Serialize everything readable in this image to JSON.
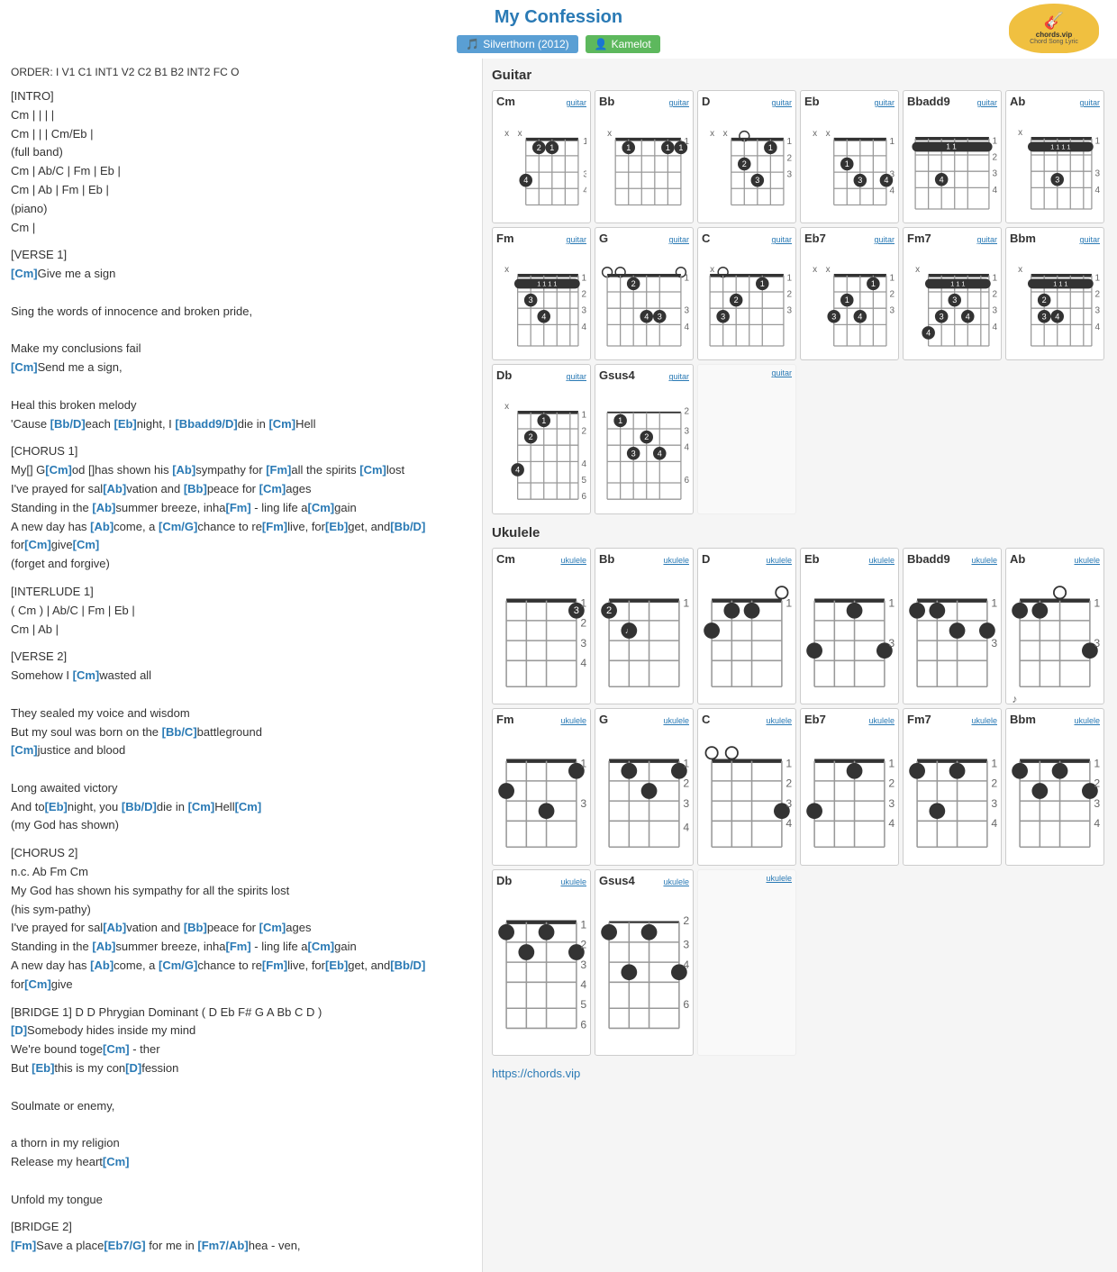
{
  "header": {
    "title": "My Confession",
    "badge_silverthorn": "Silverthorn (2012)",
    "badge_kamelot": "Kamelot",
    "logo_text": "chords.vip\nChord Song Lyric"
  },
  "order": "ORDER: I V1 C1 INT1 V2 C2 B1 B2 INT2 FC O",
  "sections": [
    {
      "label": "[INTRO]",
      "lines": [
        "Cm | | | |",
        "Cm | | | Cm/Eb |",
        "(full band)",
        "Cm | Ab/C | Fm | Eb |",
        "Cm | Ab | Fm | Eb |",
        "(piano)",
        "Cm |"
      ]
    },
    {
      "label": "[VERSE 1]",
      "lines": [
        "[Cm]Give me a sign",
        "",
        "Sing the words of innocence and broken pride,",
        "",
        "Make my conclusions fail",
        "[Cm]Send me a sign,",
        "",
        "Heal this broken melody",
        "'Cause [Bb/D]each [Eb]night, I [Bbadd9/D]die in [Cm]Hell"
      ]
    },
    {
      "label": "[CHORUS 1]",
      "lines": [
        "My[] G[Cm]od []has shown his [Ab]sympathy for [Fm]all the spirits [Cm]lost",
        "I've prayed for sal[Ab]vation and [Bb]peace for [Cm]ages",
        "Standing in the [Ab]summer breeze, inha[Fm] - ling life a[Cm]gain",
        "A new day has [Ab]come, a [Cm/G]chance to re[Fm]live, for[Eb]get, and[Bb/D]",
        "for[Cm]give[Cm]",
        "(forget and forgive)"
      ]
    },
    {
      "label": "[INTERLUDE 1]",
      "lines": [
        "( Cm ) | Ab/C | Fm | Eb |",
        "Cm | Ab |"
      ]
    },
    {
      "label": "[VERSE 2]",
      "lines": [
        "Somehow I [Cm]wasted all",
        "",
        "They sealed my voice and wisdom",
        "But my soul was born on the [Bb/C]battleground",
        "[Cm]justice and blood",
        "",
        "Long awaited victory",
        "And to[Eb]night, you [Bb/D]die in [Cm]Hell[Cm]",
        "(my God has shown)"
      ]
    },
    {
      "label": "[CHORUS 2]",
      "lines": [
        "n.c. Ab Fm Cm",
        "My God has shown his sympathy for all the spirits lost",
        "(his sym-pathy)",
        "I've prayed for sal[Ab]vation and [Bb]peace for [Cm]ages",
        "Standing in the [Ab]summer breeze, inha[Fm] - ling life a[Cm]gain",
        "A new day has [Ab]come, a [Cm/G]chance to re[Fm]live, for[Eb]get, and[Bb/D] for[Cm]give"
      ]
    },
    {
      "label": "[BRIDGE 1] D D Phrygian Dominant ( D Eb F# G A Bb C D )",
      "lines": [
        "[D]Somebody hides inside my mind",
        "We're bound toge[Cm] - ther",
        "But [Eb]this is my con[D]fession",
        "",
        "Soulmate or enemy,",
        "",
        "a thorn in my religion",
        "Release my heart[Cm]",
        "",
        "Unfold my tongue"
      ]
    },
    {
      "label": "[BRIDGE 2]",
      "lines": [
        "[Fm]Save a place[Eb7/G] for me in [Fm7/Ab]hea - ven,"
      ]
    }
  ],
  "guitar_section": {
    "title": "Guitar",
    "chords": [
      {
        "name": "Cm",
        "link": "guitar"
      },
      {
        "name": "Bb",
        "link": "guitar"
      },
      {
        "name": "D",
        "link": "guitar"
      },
      {
        "name": "Eb",
        "link": "guitar"
      },
      {
        "name": "Bbadd9",
        "link": "guitar"
      },
      {
        "name": "Ab",
        "link": "guitar"
      },
      {
        "name": "Fm",
        "link": "guitar"
      },
      {
        "name": "G",
        "link": "guitar"
      },
      {
        "name": "C",
        "link": "guitar"
      },
      {
        "name": "Eb7",
        "link": "guitar"
      },
      {
        "name": "Fm7",
        "link": "guitar"
      },
      {
        "name": "Bbm",
        "link": "guitar"
      },
      {
        "name": "Db",
        "link": "guitar"
      },
      {
        "name": "Gsus4",
        "link": "guitar"
      },
      {
        "name": "",
        "link": "guitar"
      }
    ]
  },
  "ukulele_section": {
    "title": "Ukulele",
    "chords": [
      {
        "name": "Cm",
        "link": "ukulele"
      },
      {
        "name": "Bb",
        "link": "ukulele"
      },
      {
        "name": "D",
        "link": "ukulele"
      },
      {
        "name": "Eb",
        "link": "ukulele"
      },
      {
        "name": "Bbadd9",
        "link": "ukulele"
      },
      {
        "name": "Ab",
        "link": "ukulele"
      },
      {
        "name": "Fm",
        "link": "ukulele"
      },
      {
        "name": "G",
        "link": "ukulele"
      },
      {
        "name": "C",
        "link": "ukulele"
      },
      {
        "name": "Eb7",
        "link": "ukulele"
      },
      {
        "name": "Fm7",
        "link": "ukulele"
      },
      {
        "name": "Bbm",
        "link": "ukulele"
      },
      {
        "name": "Db",
        "link": "ukulele"
      },
      {
        "name": "Gsus4",
        "link": "ukulele"
      },
      {
        "name": "",
        "link": "ukulele"
      }
    ]
  },
  "url": "https://chords.vip"
}
